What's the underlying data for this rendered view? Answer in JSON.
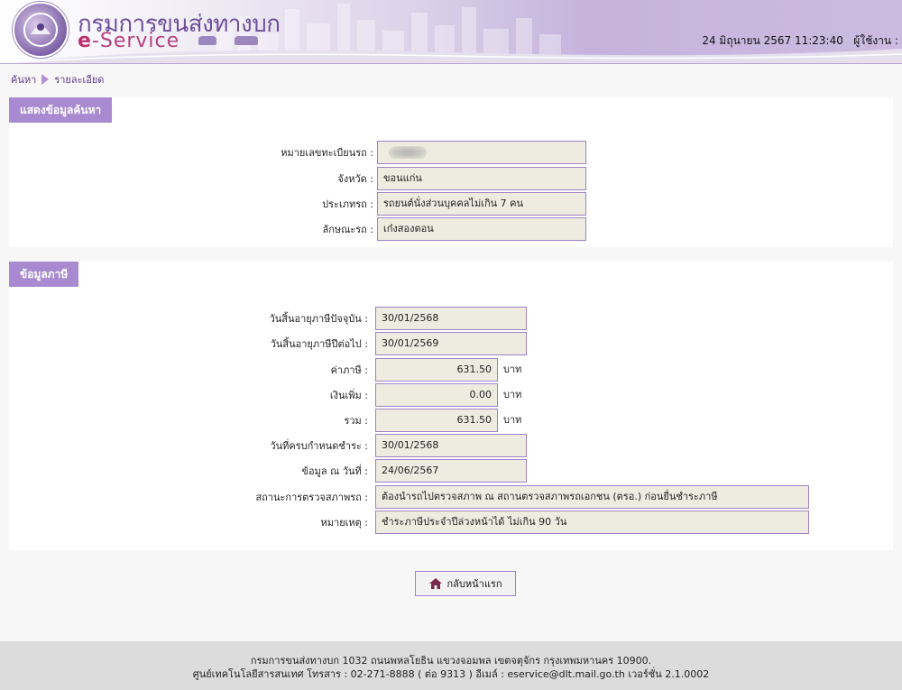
{
  "header": {
    "brand_th": "กรมการขนส่งทางบก",
    "brand_en_e": "e",
    "brand_en_rest": "-Service",
    "datetime": "24 มิถุนายน 2567 11:23:40",
    "user_label": "ผู้ใช้งาน :"
  },
  "breadcrumb": {
    "search": "ค้นหา",
    "detail": "รายละเอียด"
  },
  "search_section": {
    "title": "แสดงข้อมูลค้นหา",
    "fields": [
      {
        "label": "หมายเลขทะเบียนรถ :",
        "value": ""
      },
      {
        "label": "จังหวัด :",
        "value": "ขอนแก่น"
      },
      {
        "label": "ประเภทรถ :",
        "value": "รถยนต์นั่งส่วนบุคคลไม่เกิน 7 คน"
      },
      {
        "label": "ลักษณะรถ :",
        "value": "เก๋งสองตอน"
      }
    ]
  },
  "tax_section": {
    "title": "ข้อมูลภาษี",
    "fields": [
      {
        "label": "วันสิ้นอายุภาษีปัจจุบัน :",
        "value": "30/01/2568"
      },
      {
        "label": "วันสิ้นอายุภาษีปีต่อไป :",
        "value": "30/01/2569"
      },
      {
        "label": "ค่าภาษี :",
        "value": "631.50",
        "unit": "บาท"
      },
      {
        "label": "เงินเพิ่ม :",
        "value": "0.00",
        "unit": "บาท"
      },
      {
        "label": "รวม :",
        "value": "631.50",
        "unit": "บาท"
      },
      {
        "label": "วันที่ครบกำหนดชำระ :",
        "value": "30/01/2568"
      },
      {
        "label": "ข้อมูล ณ วันที่ :",
        "value": "24/06/2567"
      },
      {
        "label": "สถานะการตรวจสภาพรถ :",
        "value": "ต้องนำรถไปตรวจสภาพ ณ สถานตรวจสภาพรถเอกชน (ตรอ.) ก่อนยื่นชำระภาษี"
      },
      {
        "label": "หมายเหตุ :",
        "value": "ชำระภาษีประจำปีล่วงหน้าได้ ไม่เกิน 90 วัน"
      }
    ]
  },
  "home_button": "กลับหน้าแรก",
  "footer": {
    "line1": "กรมการขนส่งทางบก 1032 ถนนพหลโยธิน แขวงจอมพล เขตจตุจักร กรุงเทพมหานคร 10900.",
    "line2": "ศูนย์เทคโนโลยีสารสนเทศ โทรสาร : 02-271-8888 ( ต่อ 9313 ) อีเมล์ : eservice@dlt.mail.go.th เวอร์ชั่น 2.1.0002"
  },
  "colors": {
    "accent": "#a98ad0",
    "field_border": "#a081c7",
    "field_bg": "#eeece0",
    "brand": "#6d4f99"
  }
}
